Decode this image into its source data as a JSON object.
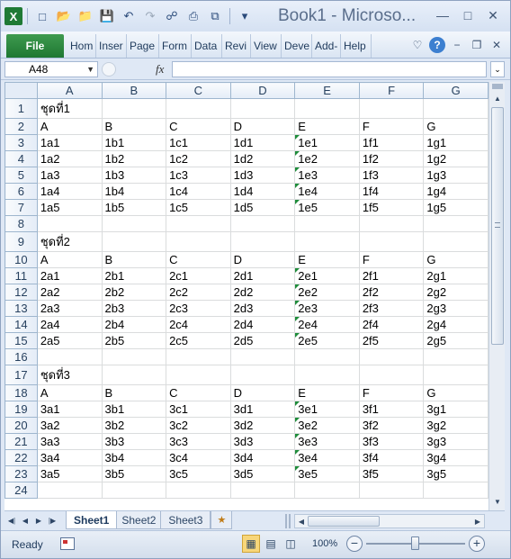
{
  "window": {
    "title": "Book1 - Microso...",
    "app_logo": "X"
  },
  "qat": {
    "icons": [
      "new-icon",
      "open-icon",
      "folder-icon",
      "save-icon",
      "undo-icon",
      "redo-icon",
      "customize-icon",
      "print-preview-icon",
      "print-icon",
      "select-icon"
    ]
  },
  "ribbon": {
    "file_label": "File",
    "tabs": [
      "Hom",
      "Inser",
      "Page",
      "Form",
      "Data",
      "Revi",
      "View",
      "Deve",
      "Add-",
      "Help"
    ]
  },
  "formula_bar": {
    "name_box": "A48",
    "fx_label": "fx",
    "formula": ""
  },
  "grid": {
    "columns": [
      "A",
      "B",
      "C",
      "D",
      "E",
      "F",
      "G"
    ],
    "rows": [
      {
        "n": "1",
        "cells": [
          "ชุดที่1",
          "",
          "",
          "",
          "",
          "",
          ""
        ]
      },
      {
        "n": "2",
        "cells": [
          "A",
          "B",
          "C",
          "D",
          "E",
          "F",
          "G"
        ]
      },
      {
        "n": "3",
        "cells": [
          "1a1",
          "1b1",
          "1c1",
          "1d1",
          "1e1",
          "1f1",
          "1g1"
        ]
      },
      {
        "n": "4",
        "cells": [
          "1a2",
          "1b2",
          "1c2",
          "1d2",
          "1e2",
          "1f2",
          "1g2"
        ]
      },
      {
        "n": "5",
        "cells": [
          "1a3",
          "1b3",
          "1c3",
          "1d3",
          "1e3",
          "1f3",
          "1g3"
        ]
      },
      {
        "n": "6",
        "cells": [
          "1a4",
          "1b4",
          "1c4",
          "1d4",
          "1e4",
          "1f4",
          "1g4"
        ]
      },
      {
        "n": "7",
        "cells": [
          "1a5",
          "1b5",
          "1c5",
          "1d5",
          "1e5",
          "1f5",
          "1g5"
        ]
      },
      {
        "n": "8",
        "cells": [
          "",
          "",
          "",
          "",
          "",
          "",
          ""
        ]
      },
      {
        "n": "9",
        "cells": [
          "ชุดที่2",
          "",
          "",
          "",
          "",
          "",
          ""
        ]
      },
      {
        "n": "10",
        "cells": [
          "A",
          "B",
          "C",
          "D",
          "E",
          "F",
          "G"
        ]
      },
      {
        "n": "11",
        "cells": [
          "2a1",
          "2b1",
          "2c1",
          "2d1",
          "2e1",
          "2f1",
          "2g1"
        ]
      },
      {
        "n": "12",
        "cells": [
          "2a2",
          "2b2",
          "2c2",
          "2d2",
          "2e2",
          "2f2",
          "2g2"
        ]
      },
      {
        "n": "13",
        "cells": [
          "2a3",
          "2b3",
          "2c3",
          "2d3",
          "2e3",
          "2f3",
          "2g3"
        ]
      },
      {
        "n": "14",
        "cells": [
          "2a4",
          "2b4",
          "2c4",
          "2d4",
          "2e4",
          "2f4",
          "2g4"
        ]
      },
      {
        "n": "15",
        "cells": [
          "2a5",
          "2b5",
          "2c5",
          "2d5",
          "2e5",
          "2f5",
          "2g5"
        ]
      },
      {
        "n": "16",
        "cells": [
          "",
          "",
          "",
          "",
          "",
          "",
          ""
        ]
      },
      {
        "n": "17",
        "cells": [
          "ชุดที่3",
          "",
          "",
          "",
          "",
          "",
          ""
        ]
      },
      {
        "n": "18",
        "cells": [
          "A",
          "B",
          "C",
          "D",
          "E",
          "F",
          "G"
        ]
      },
      {
        "n": "19",
        "cells": [
          "3a1",
          "3b1",
          "3c1",
          "3d1",
          "3e1",
          "3f1",
          "3g1"
        ]
      },
      {
        "n": "20",
        "cells": [
          "3a2",
          "3b2",
          "3c2",
          "3d2",
          "3e2",
          "3f2",
          "3g2"
        ]
      },
      {
        "n": "21",
        "cells": [
          "3a3",
          "3b3",
          "3c3",
          "3d3",
          "3e3",
          "3f3",
          "3g3"
        ]
      },
      {
        "n": "22",
        "cells": [
          "3a4",
          "3b4",
          "3c4",
          "3d4",
          "3e4",
          "3f4",
          "3g4"
        ]
      },
      {
        "n": "23",
        "cells": [
          "3a5",
          "3b5",
          "3c5",
          "3d5",
          "3e5",
          "3f5",
          "3g5"
        ]
      },
      {
        "n": "24",
        "cells": [
          "",
          "",
          "",
          "",
          "",
          "",
          ""
        ]
      }
    ],
    "flagged_column": 4,
    "flag_color": "#1e8c3a"
  },
  "sheets": {
    "tabs": [
      "Sheet1",
      "Sheet2",
      "Sheet3"
    ],
    "active": 0
  },
  "status": {
    "ready_text": "Ready",
    "zoom_text": "100%",
    "zoom_minus": "−",
    "zoom_plus": "+"
  },
  "colors": {
    "file_tab": "#1e7832",
    "accent": "#3c7fd0"
  }
}
